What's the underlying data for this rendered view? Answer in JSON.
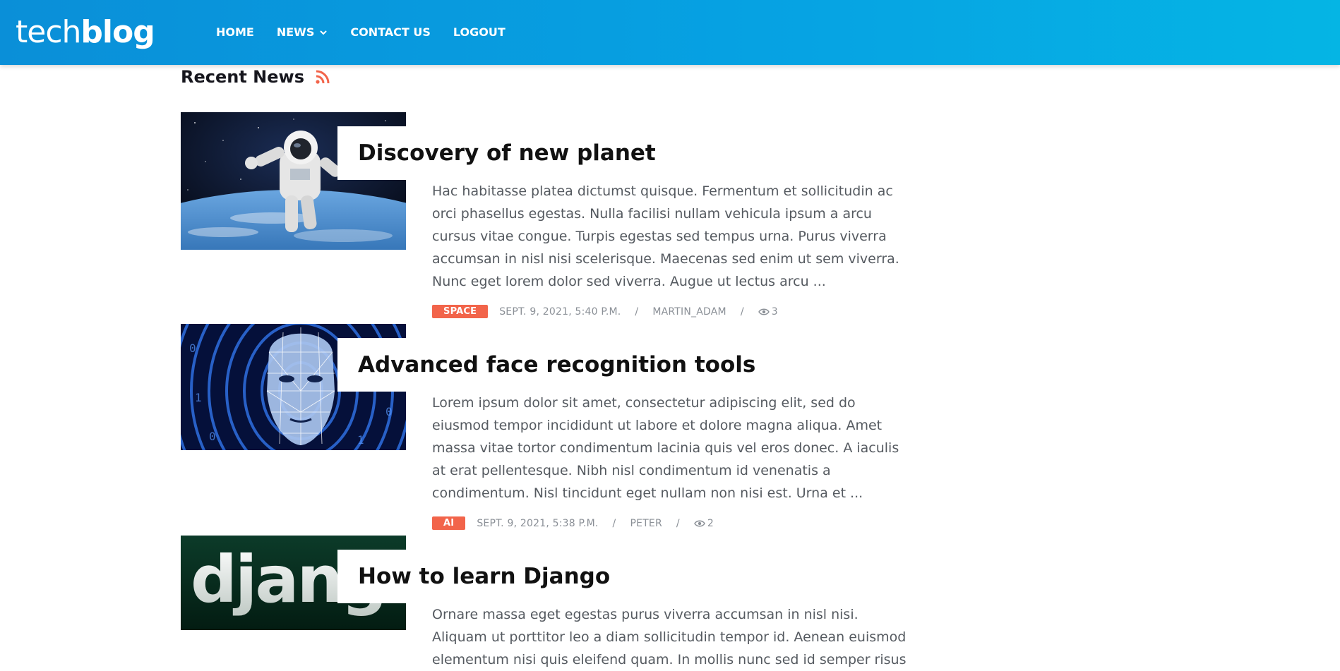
{
  "header": {
    "logo_part1": "tech",
    "logo_part2": "blog",
    "nav": [
      "HOME",
      "NEWS",
      "CONTACT US",
      "LOGOUT"
    ]
  },
  "section": {
    "title": "Recent News"
  },
  "colors": {
    "accent": "#f2644a",
    "header_start": "#0a8fd8",
    "header_end": "#05b5e4"
  },
  "posts": [
    {
      "title": "Discovery of new planet",
      "excerpt": "Hac habitasse platea dictumst quisque. Fermentum et sollicitudin ac orci phasellus egestas. Nulla facilisi nullam vehicula ipsum a arcu cursus vitae congue. Turpis egestas sed tempus urna. Purus viverra accumsan in nisl nisi scelerisque. Maecenas sed enim ut sem viverra. Nunc eget lorem dolor sed viverra. Augue ut lectus arcu ...",
      "tag": "SPACE",
      "date": "SEPT. 9, 2021, 5:40 P.M.",
      "author": "MARTIN_ADAM",
      "views": "3",
      "image_icon": "astronaut-image"
    },
    {
      "title": "Advanced face recognition tools",
      "excerpt": "Lorem ipsum dolor sit amet, consectetur adipiscing elit, sed do eiusmod tempor incididunt ut labore et dolore magna aliqua. Amet massa vitae tortor condimentum lacinia quis vel eros donec. A iaculis at erat pellentesque. Nibh nisl condimentum id venenatis a condimentum. Nisl tincidunt eget nullam non nisi est. Urna et ...",
      "tag": "AI",
      "date": "SEPT. 9, 2021, 5:38 P.M.",
      "author": "PETER",
      "views": "2",
      "image_icon": "face-recognition-image"
    },
    {
      "title": "How to learn Django",
      "excerpt": "Ornare massa eget egestas purus viverra accumsan in nisl nisi. Aliquam ut porttitor leo a diam sollicitudin tempor id. Aenean euismod elementum nisi quis eleifend quam. In mollis nunc sed id semper risus",
      "image_text": "djang",
      "image_icon": "django-logo-image"
    }
  ]
}
